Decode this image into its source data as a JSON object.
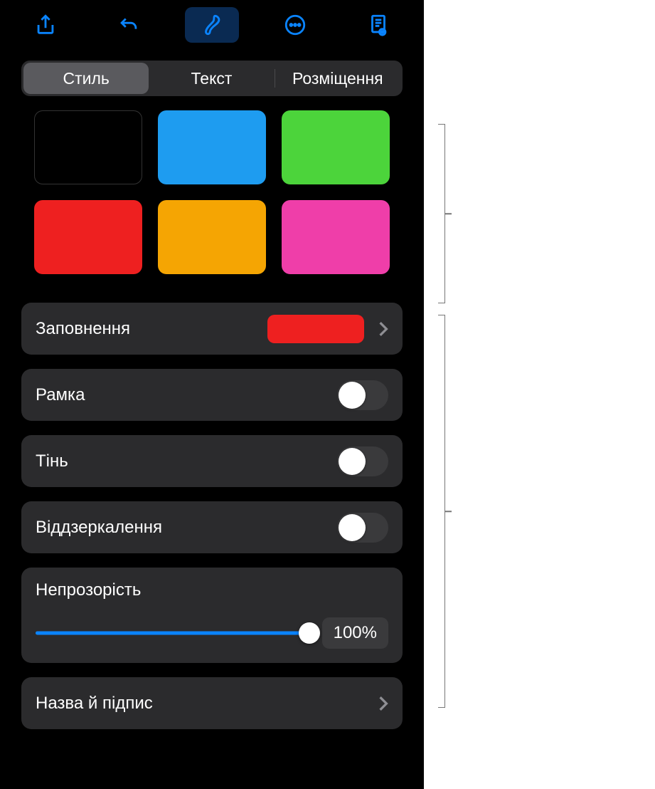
{
  "tabs": {
    "style": "Стиль",
    "text": "Текст",
    "arrange": "Розміщення"
  },
  "swatches": [
    {
      "name": "black",
      "color": "#000000"
    },
    {
      "name": "blue",
      "color": "#1e9cf0"
    },
    {
      "name": "green",
      "color": "#4cd43b"
    },
    {
      "name": "red",
      "color": "#ee2020"
    },
    {
      "name": "orange",
      "color": "#f5a503"
    },
    {
      "name": "pink",
      "color": "#ef3ea9"
    }
  ],
  "fill": {
    "label": "Заповнення",
    "swatch_color": "#ee2020"
  },
  "border": {
    "label": "Рамка",
    "on": false
  },
  "shadow": {
    "label": "Тінь",
    "on": false
  },
  "reflection": {
    "label": "Віддзеркалення",
    "on": false
  },
  "opacity": {
    "label": "Непрозорість",
    "value_text": "100%",
    "percent": 100
  },
  "title_caption": {
    "label": "Назва й підпис"
  }
}
